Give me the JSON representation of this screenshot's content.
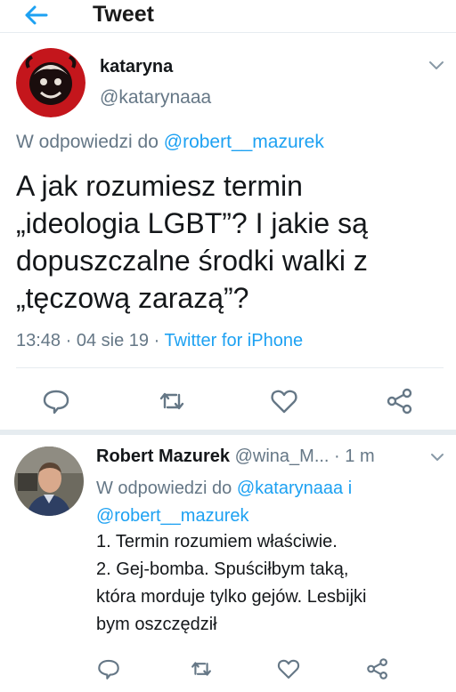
{
  "header": {
    "title": "Tweet",
    "back_icon": "arrow-left-icon",
    "accent": "#1da1f2"
  },
  "tweet1": {
    "name": "kataryna",
    "handle": "@katarynaaa",
    "reply_prefix": "W odpowiedzi do ",
    "reply_to": "@robert__mazurek",
    "text_lines": [
      "A jak rozumiesz termin",
      "„ideologia LGBT”? I jakie są",
      "dopuszczalne środki walki z",
      "„tęczową zarazą”?"
    ],
    "time": "13:48",
    "date": "04 sie 19",
    "dot": " · ",
    "source": "Twitter for iPhone"
  },
  "tweet2": {
    "name": "Robert Mazurek",
    "handle": "@wina_M...",
    "time": " · 1 m",
    "reply_prefix": "W odpowiedzi do ",
    "reply_to_1": "@katarynaaa",
    "reply_and": " i ",
    "reply_to_2": "@robert__mazurek",
    "text_lines": [
      "1. Termin rozumiem właściwie.",
      "2. Gej-bomba. Spuściłbym taką,",
      "która morduje tylko gejów. Lesbijki",
      "bym oszczędził"
    ]
  },
  "actions": [
    "reply-icon",
    "retweet-icon",
    "like-icon",
    "share-icon"
  ],
  "colors": {
    "link": "#1da1f2",
    "muted": "#657786",
    "text": "#14171a",
    "icon": "#657786"
  }
}
